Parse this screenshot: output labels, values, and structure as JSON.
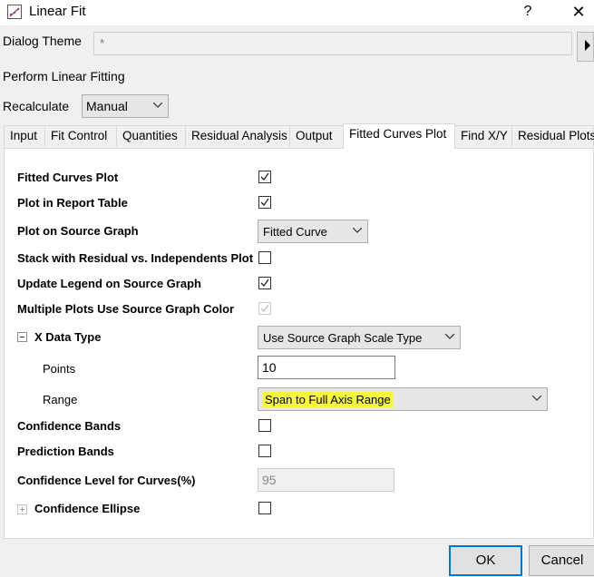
{
  "window": {
    "title": "Linear Fit",
    "help": "?",
    "close": "✕"
  },
  "theme": {
    "label": "Dialog Theme",
    "value": "*"
  },
  "description": "Perform Linear Fitting",
  "recalculate": {
    "label": "Recalculate",
    "value": "Manual"
  },
  "tabs": [
    "Input",
    "Fit Control",
    "Quantities",
    "Residual Analysis",
    "Output",
    "Fitted Curves Plot",
    "Find X/Y",
    "Residual Plots"
  ],
  "active_tab": "Fitted Curves Plot",
  "options": {
    "fitted_curves_plot": {
      "label": "Fitted Curves Plot",
      "checked": true
    },
    "plot_in_report_table": {
      "label": "Plot in Report Table",
      "checked": true
    },
    "plot_on_source_graph": {
      "label": "Plot on Source Graph",
      "value": "Fitted Curve"
    },
    "stack_residual": {
      "label": "Stack with Residual vs. Independents Plot",
      "checked": false
    },
    "update_legend": {
      "label": "Update Legend on Source Graph",
      "checked": true
    },
    "multiple_plots_color": {
      "label": "Multiple Plots Use Source Graph Color",
      "checked": true,
      "disabled": true
    },
    "x_data_type": {
      "label": "X Data Type",
      "value": "Use Source Graph Scale Type",
      "expanded": true
    },
    "points": {
      "label": "Points",
      "value": "10"
    },
    "range": {
      "label": "Range",
      "value": "Span to Full Axis Range",
      "highlight": "#f7f73a"
    },
    "confidence_bands": {
      "label": "Confidence Bands",
      "checked": false
    },
    "prediction_bands": {
      "label": "Prediction Bands",
      "checked": false
    },
    "confidence_level": {
      "label": "Confidence Level for Curves(%)",
      "value": "95"
    },
    "confidence_ellipse": {
      "label": "Confidence Ellipse",
      "checked": false,
      "expanded": false
    }
  },
  "buttons": {
    "ok": "OK",
    "cancel": "Cancel"
  },
  "icons": [
    "app-icon",
    "help-icon",
    "close-icon",
    "expand-arrow-icon",
    "chevron-down-icon",
    "check-icon",
    "tree-collapse-icon",
    "tree-expand-icon"
  ],
  "colors": {
    "accent": "#0078d7",
    "highlight": "#f7f73a"
  }
}
